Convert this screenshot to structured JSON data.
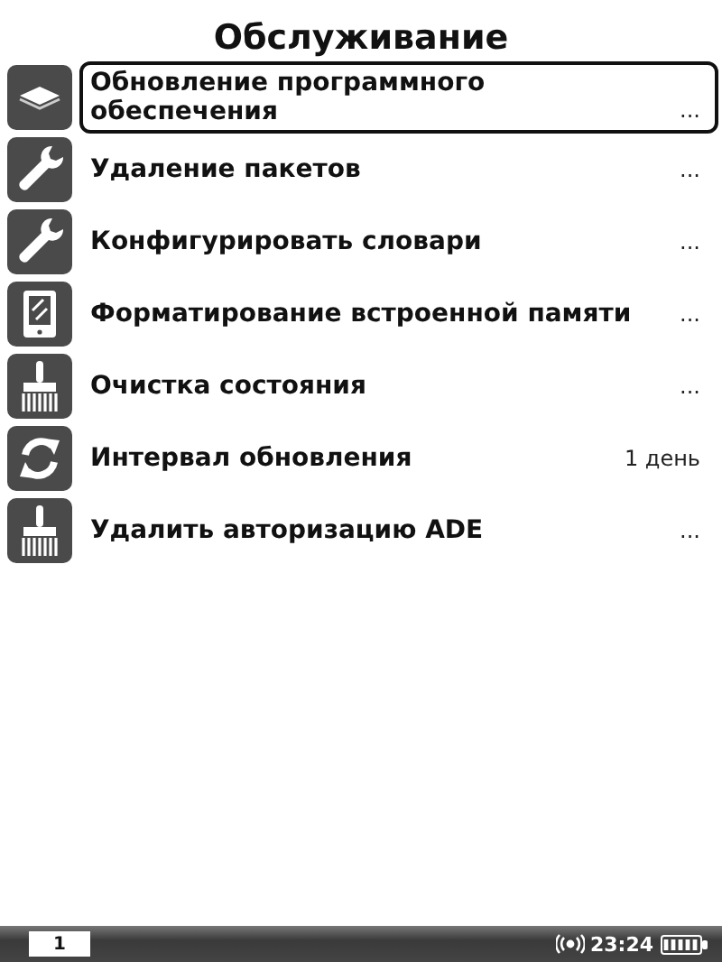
{
  "title": "Обслуживание",
  "items": [
    {
      "label": "Обновление программного обеспечения",
      "value": "...",
      "selected": true
    },
    {
      "label": "Удаление пакетов",
      "value": "...",
      "selected": false
    },
    {
      "label": "Конфигурировать словари",
      "value": "...",
      "selected": false
    },
    {
      "label": "Форматирование встроенной памяти",
      "value": "...",
      "selected": false
    },
    {
      "label": "Очистка состояния",
      "value": "...",
      "selected": false
    },
    {
      "label": "Интервал обновления",
      "value": "1 день",
      "selected": false
    },
    {
      "label": "Удалить авторизацию ADE",
      "value": "...",
      "selected": false
    }
  ],
  "status_bar": {
    "page": "1",
    "time": "23:24"
  }
}
